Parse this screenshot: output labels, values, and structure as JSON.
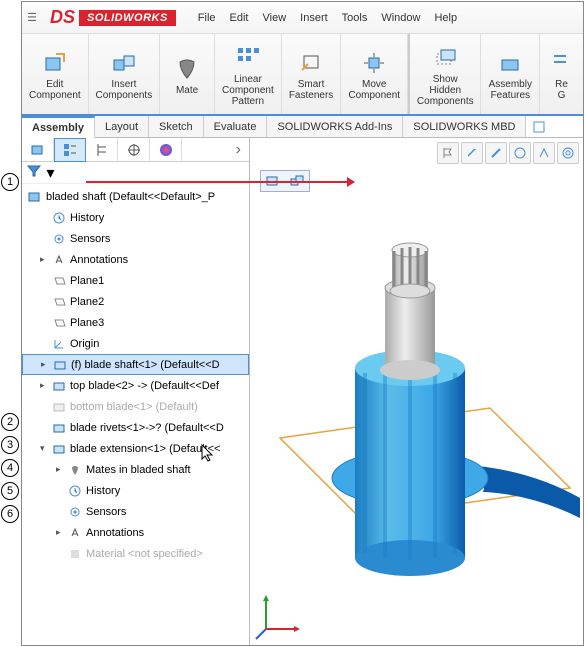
{
  "app": {
    "logo_ds": "DS",
    "logo_text": "SOLIDWORKS"
  },
  "menubar": [
    "File",
    "Edit",
    "View",
    "Insert",
    "Tools",
    "Window",
    "Help"
  ],
  "ribbon": [
    {
      "label": "Edit\nComponent",
      "icon": "edit-component-icon"
    },
    {
      "label": "Insert\nComponents",
      "icon": "insert-components-icon"
    },
    {
      "label": "Mate",
      "icon": "mate-icon"
    },
    {
      "label": "Linear\nComponent\nPattern",
      "icon": "linear-pattern-icon"
    },
    {
      "label": "Smart\nFasteners",
      "icon": "smart-fasteners-icon"
    },
    {
      "label": "Move\nComponent",
      "icon": "move-component-icon"
    },
    {
      "label": "Show\nHidden\nComponents",
      "icon": "show-hidden-icon"
    },
    {
      "label": "Assembly\nFeatures",
      "icon": "assembly-features-icon"
    },
    {
      "label": "Re\nG",
      "icon": "ref-geom-icon"
    }
  ],
  "tabs": [
    "Assembly",
    "Layout",
    "Sketch",
    "Evaluate",
    "SOLIDWORKS Add-Ins",
    "SOLIDWORKS MBD"
  ],
  "tree": {
    "root": "bladed shaft  (Default<<Default>_P",
    "items": [
      {
        "label": "History",
        "icon": "history-icon"
      },
      {
        "label": "Sensors",
        "icon": "sensors-icon"
      },
      {
        "label": "Annotations",
        "icon": "annotations-icon",
        "exp": "▸"
      },
      {
        "label": "Plane1",
        "icon": "plane-icon"
      },
      {
        "label": "Plane2",
        "icon": "plane-icon"
      },
      {
        "label": "Plane3",
        "icon": "plane-icon"
      },
      {
        "label": "Origin",
        "icon": "origin-icon"
      },
      {
        "label": "(f) blade shaft<1> (Default<<D",
        "icon": "part-icon",
        "exp": "▸",
        "selected": true
      },
      {
        "label": "top blade<2> -> (Default<<Def",
        "icon": "part-icon",
        "exp": "▸"
      },
      {
        "label": "bottom blade<1> (Default)",
        "icon": "part-icon",
        "suppressed": true
      },
      {
        "label": "blade rivets<1>->? (Default<<D",
        "icon": "part-icon"
      },
      {
        "label": "blade extension<1> (Default<<",
        "icon": "part-icon",
        "exp": "▾"
      }
    ],
    "sub": [
      {
        "label": "Mates in bladed shaft",
        "icon": "mates-icon",
        "exp": "▸"
      },
      {
        "label": "History",
        "icon": "history-icon"
      },
      {
        "label": "Sensors",
        "icon": "sensors-icon"
      },
      {
        "label": "Annotations",
        "icon": "annotations-icon",
        "exp": "▸"
      },
      {
        "label": "Material <not specified>",
        "icon": "material-icon",
        "suppressed": true
      }
    ]
  },
  "callouts": [
    "1",
    "2",
    "3",
    "4",
    "5",
    "6"
  ],
  "colors": {
    "brand_red": "#d9232e",
    "blue_accent": "#4a8fd8",
    "model_blue": "#3fa9e8",
    "model_dark": "#0b5aa9",
    "sketch_orange": "#e8a23f"
  }
}
